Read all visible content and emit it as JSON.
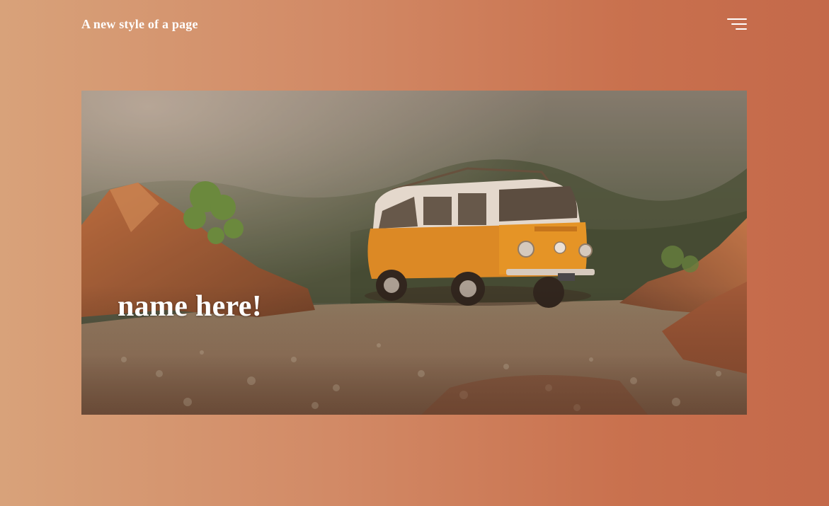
{
  "header": {
    "site_title": "A new style of a page",
    "menu_icon": "hamburger-menu-icon"
  },
  "hero": {
    "heading": "name here!",
    "image_subject": "orange camper van parked on rocky gravel ground in front of a misty forested hillside"
  },
  "colors": {
    "background_left": "#d8a27a",
    "background_right": "#c4694a",
    "text": "#ffffff",
    "van_body": "#e08a1e"
  }
}
